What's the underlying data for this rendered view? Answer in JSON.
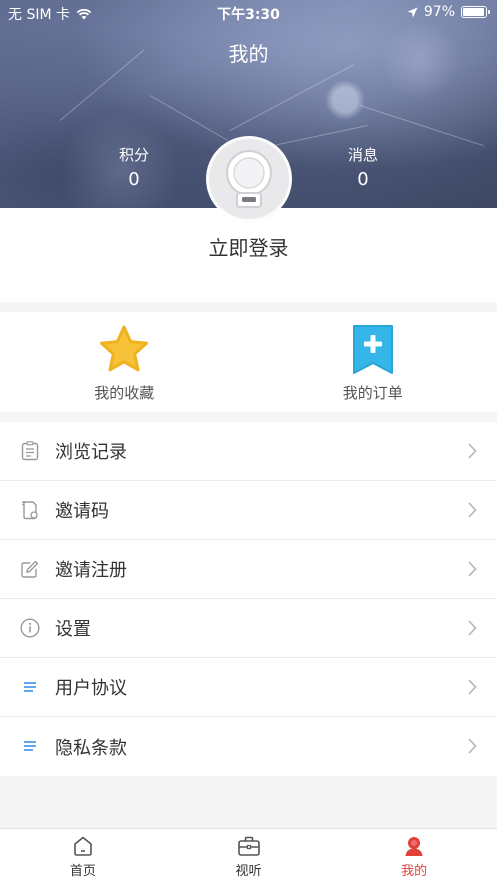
{
  "status_bar": {
    "carrier": "无 SIM 卡",
    "time": "下午3:30",
    "battery": "97%"
  },
  "header": {
    "title": "我的",
    "points": {
      "label": "积分",
      "value": "0"
    },
    "messages": {
      "label": "消息",
      "value": "0"
    }
  },
  "login": {
    "label": "立即登录"
  },
  "quick_actions": [
    {
      "label": "我的收藏",
      "icon": "star-icon"
    },
    {
      "label": "我的订单",
      "icon": "bookmark-plus-icon"
    }
  ],
  "menu": [
    {
      "label": "浏览记录",
      "icon": "history-icon"
    },
    {
      "label": "邀请码",
      "icon": "invite-code-icon"
    },
    {
      "label": "邀请注册",
      "icon": "edit-icon"
    },
    {
      "label": "设置",
      "icon": "info-icon"
    },
    {
      "label": "用户协议",
      "icon": "list-icon"
    },
    {
      "label": "隐私条款",
      "icon": "list-icon"
    }
  ],
  "tabbar": [
    {
      "label": "首页",
      "icon": "home-icon",
      "active": false
    },
    {
      "label": "视听",
      "icon": "briefcase-icon",
      "active": false
    },
    {
      "label": "我的",
      "icon": "user-icon",
      "active": true
    }
  ],
  "colors": {
    "accent": "#e2403a",
    "star": "#f7c23a",
    "bookmark": "#34b6e8",
    "list_icon": "#3b8fe6"
  }
}
